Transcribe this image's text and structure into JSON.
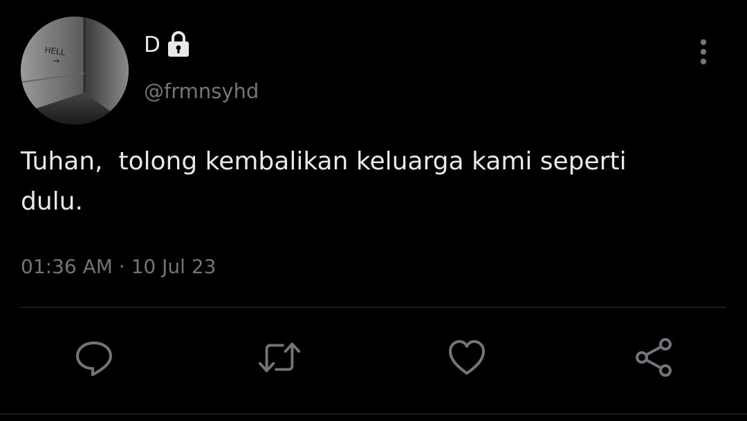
{
  "user": {
    "display_name": "D",
    "handle": "@frmnsyhd",
    "protected": true,
    "avatar_text": "HELL"
  },
  "tweet": {
    "text": "Tuhan,  tolong kembalikan keluarga kami seperti\ndulu.",
    "timestamp": "01:36 AM · 10 Jul 23"
  },
  "actions": [
    {
      "name": "reply",
      "icon": "comment-icon"
    },
    {
      "name": "retweet",
      "icon": "retweet-icon"
    },
    {
      "name": "like",
      "icon": "heart-icon"
    },
    {
      "name": "share",
      "icon": "share-icon"
    }
  ],
  "colors": {
    "background": "#000000",
    "primary_text": "#e7e9ea",
    "secondary_text": "#71767b",
    "icon": "#71767b",
    "divider": "#2f3336"
  }
}
